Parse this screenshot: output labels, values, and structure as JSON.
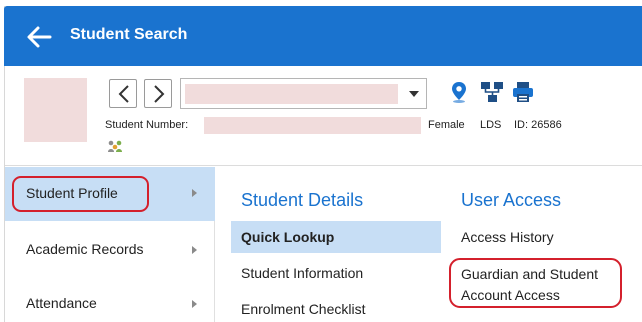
{
  "header": {
    "title": "Student Search",
    "background": "#1a73cf"
  },
  "student": {
    "number_label": "Student Number:",
    "gender": "Female",
    "program": "LDS",
    "id_text": "ID: 26586"
  },
  "left_menu": {
    "items": [
      {
        "label": "Student Profile",
        "active": true
      },
      {
        "label": "Academic Records",
        "active": false
      },
      {
        "label": "Attendance",
        "active": false
      }
    ]
  },
  "student_details": {
    "title": "Student Details",
    "links": [
      "Quick Lookup",
      "Student Information",
      "Enrolment Checklist"
    ],
    "selected": "Quick Lookup"
  },
  "user_access": {
    "title": "User Access",
    "links": [
      "Access History",
      "Guardian and Student Account Access"
    ]
  },
  "colors": {
    "accent": "#1a73cf",
    "selection": "#c7def5",
    "highlight_ring": "#d4202c",
    "redaction": "#f1dcdc"
  },
  "icons": [
    "back-arrow-icon",
    "chevron-left-icon",
    "chevron-right-icon",
    "map-pin-icon",
    "org-chart-icon",
    "printer-icon",
    "family-icon",
    "chevron-right-small-icon"
  ]
}
